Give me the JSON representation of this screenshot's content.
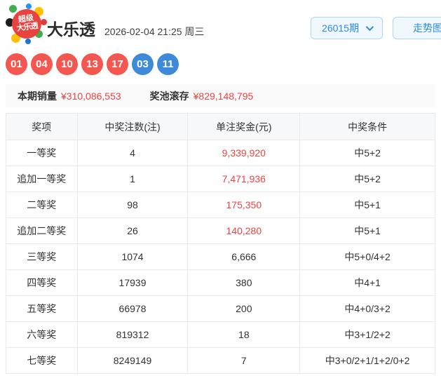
{
  "header": {
    "logo_line1": "超级",
    "logo_line2": "大乐透",
    "title": "大乐透",
    "datetime": "2026-02-04 21:25 周三",
    "issue_select_value": "26015期",
    "trend_button_label": "走势图"
  },
  "draw": {
    "front_numbers": [
      "01",
      "04",
      "10",
      "13",
      "17"
    ],
    "back_numbers": [
      "03",
      "11"
    ]
  },
  "sales": {
    "sales_label": "本期销量",
    "sales_value": "¥310,086,553",
    "pool_label": "奖池滚存",
    "pool_value": "¥829,148,795"
  },
  "prize_table": {
    "columns": [
      "奖项",
      "中奖注数(注)",
      "单注奖金(元)",
      "中奖条件"
    ],
    "rows": [
      {
        "name": "一等奖",
        "count": "4",
        "amount": "9,339,920",
        "amount_red": true,
        "condition": "中5+2"
      },
      {
        "name": "追加一等奖",
        "count": "1",
        "amount": "7,471,936",
        "amount_red": true,
        "condition": "中5+2"
      },
      {
        "name": "二等奖",
        "count": "98",
        "amount": "175,350",
        "amount_red": true,
        "condition": "中5+1"
      },
      {
        "name": "追加二等奖",
        "count": "26",
        "amount": "140,280",
        "amount_red": true,
        "condition": "中5+1"
      },
      {
        "name": "三等奖",
        "count": "1074",
        "amount": "6,666",
        "amount_red": false,
        "condition": "中5+0/4+2"
      },
      {
        "name": "四等奖",
        "count": "17939",
        "amount": "380",
        "amount_red": false,
        "condition": "中4+1"
      },
      {
        "name": "五等奖",
        "count": "66978",
        "amount": "200",
        "amount_red": false,
        "condition": "中4+0/3+2"
      },
      {
        "name": "六等奖",
        "count": "819312",
        "amount": "18",
        "amount_red": false,
        "condition": "中3+1/2+2"
      },
      {
        "name": "七等奖",
        "count": "8249149",
        "amount": "7",
        "amount_red": false,
        "condition": "中3+0/2+1/1+2/0+2"
      }
    ]
  },
  "colors": {
    "accent_red": "#f24141",
    "ball_red": "#f4574f",
    "ball_blue": "#3f8ad8",
    "link_blue": "#2a8ce2",
    "ctrl_border": "#aed6f2",
    "ctrl_bg": "#f0f8fe",
    "table_border": "#e9e9e9",
    "table_head_bg": "#f7f8fa"
  }
}
